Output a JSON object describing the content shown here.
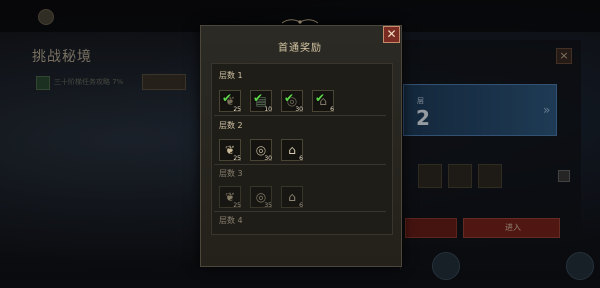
{
  "background": {
    "title": "挑战秘境",
    "hint": "三十阶梯任务攻略 7%",
    "level_label": "层",
    "level_value": "2",
    "confirm_label": "进入"
  },
  "dialog": {
    "title": "首通奖励",
    "close_icon": "close-icon",
    "tiers": [
      {
        "label": "层数 1",
        "rewards": [
          {
            "icon": "feather-icon",
            "count": "25",
            "claimed": true
          },
          {
            "icon": "bandage-icon",
            "count": "10",
            "claimed": true
          },
          {
            "icon": "coin-icon",
            "count": "30",
            "claimed": true
          },
          {
            "icon": "tooth-icon",
            "count": "6",
            "claimed": true
          }
        ]
      },
      {
        "label": "层数 2",
        "rewards": [
          {
            "icon": "feather-icon",
            "count": "25",
            "claimed": false
          },
          {
            "icon": "coin-icon",
            "count": "30",
            "claimed": false
          },
          {
            "icon": "tooth-icon",
            "count": "6",
            "claimed": false
          }
        ]
      },
      {
        "label": "层数 3",
        "rewards": [
          {
            "icon": "feather-icon",
            "count": "25",
            "claimed": false
          },
          {
            "icon": "coin-icon",
            "count": "35",
            "claimed": false
          },
          {
            "icon": "tooth-icon",
            "count": "6",
            "claimed": false
          }
        ]
      },
      {
        "label": "层数 4",
        "rewards": []
      }
    ]
  },
  "colors": {
    "check": "#5ed84a",
    "close_bg": "#7a2c22"
  }
}
